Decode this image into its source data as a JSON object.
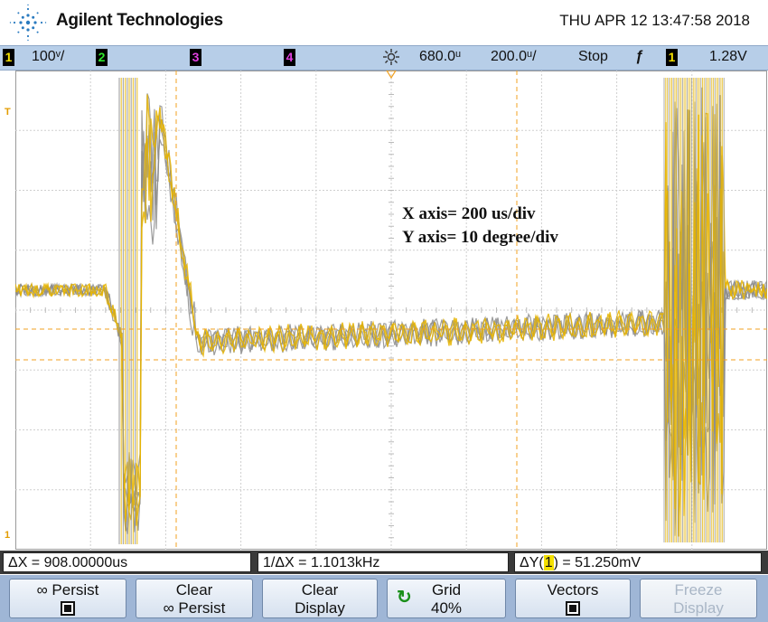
{
  "header": {
    "brand": "Agilent Technologies",
    "datetime": "THU APR 12 13:47:58 2018"
  },
  "status": {
    "ch1_num": "1",
    "ch1_scale": "100ᵛ/",
    "ch2_num": "2",
    "ch3_num": "3",
    "ch4_num": "4",
    "delay": "680.0ᵘ",
    "timebase": "200.0ᵘ/",
    "run_state": "Stop",
    "trigger_slope": "ƒ",
    "trigger_ch": "1",
    "trigger_level": "1.28V"
  },
  "markers": {
    "trigger": "T",
    "ground": "1"
  },
  "annotation": {
    "x_axis": "X axis= 200 us/div",
    "y_axis": "Y axis= 10 degree/div"
  },
  "readouts": {
    "delta_x": "ΔX = 908.00000us",
    "inv_delta_x": "1/ΔX = 1.1013kHz",
    "delta_y_prefix": "ΔY(",
    "delta_y_ch": "1",
    "delta_y_suffix": ") = 51.250mV"
  },
  "softkeys": {
    "persist_l1": "∞ Persist",
    "clear_persist_l1": "Clear",
    "clear_persist_l2": "∞ Persist",
    "clear_display_l1": "Clear",
    "clear_display_l2": "Display",
    "grid_l1": "Grid",
    "grid_l2": "40%",
    "vectors_l1": "Vectors",
    "freeze_l1": "Freeze",
    "freeze_l2": "Display"
  },
  "colors": {
    "trace_yellow": "#e6b400",
    "trace_gray": "#8c8c8c",
    "cursor_orange": "#f0a020",
    "status_bg": "#b7cee8"
  }
}
